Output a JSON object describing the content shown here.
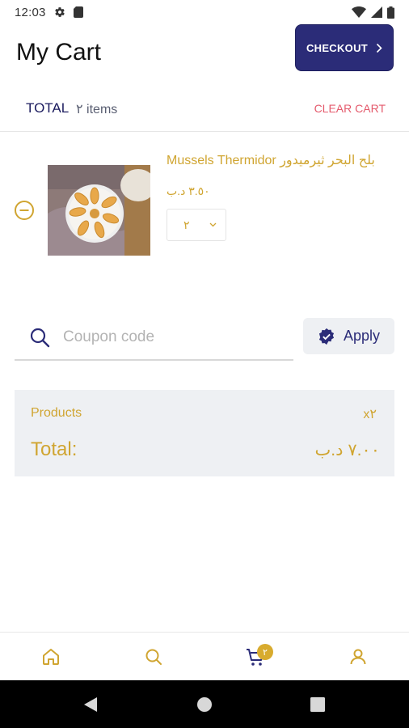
{
  "status_bar": {
    "time": "12:03",
    "icons": [
      "gear-icon",
      "sim-card-icon",
      "wifi-icon",
      "signal-icon",
      "battery-icon"
    ]
  },
  "header": {
    "title": "My Cart",
    "checkout_label": "CHECKOUT",
    "checkout_color": "#2b2c78"
  },
  "summary_row": {
    "total_label": "TOTAL",
    "items_text": "٢ items",
    "clear_cart_label": "CLEAR CART",
    "clear_cart_color": "#e45a6c"
  },
  "cart": {
    "items": [
      {
        "name": "Mussels Thermidor بلح البحر ثيرميدور",
        "price": "٣.٥٠ د.ب",
        "quantity": "٢",
        "image": "plate-of-mussels-image"
      }
    ]
  },
  "coupon": {
    "placeholder": "Coupon code",
    "value": "",
    "apply_label": "Apply"
  },
  "order_summary": {
    "products_label": "Products",
    "products_count": "x٢",
    "total_label": "Total:",
    "total_value": "٧.٠٠ د.ب",
    "accent_color": "#d0a531"
  },
  "bottom_nav": {
    "items": [
      {
        "name": "home",
        "icon": "home-icon"
      },
      {
        "name": "search",
        "icon": "search-icon"
      },
      {
        "name": "cart",
        "icon": "cart-icon",
        "badge": "٢"
      },
      {
        "name": "profile",
        "icon": "user-icon"
      }
    ]
  },
  "system_nav": {
    "icons": [
      "back-icon",
      "home-circle-icon",
      "recents-icon"
    ]
  }
}
